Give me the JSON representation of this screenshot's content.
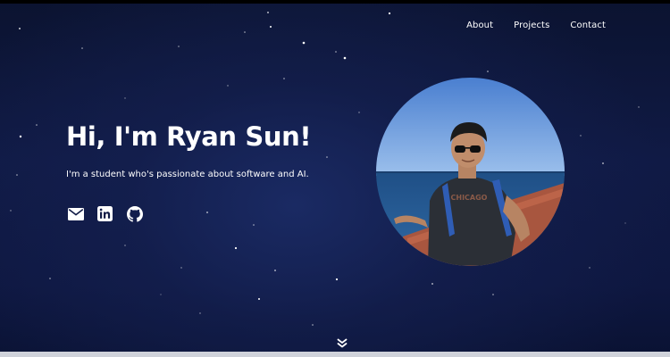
{
  "nav": {
    "items": [
      {
        "label": "About"
      },
      {
        "label": "Projects"
      },
      {
        "label": "Contact"
      }
    ]
  },
  "hero": {
    "title": "Hi, I'm Ryan Sun!",
    "subtitle": "I'm a student who's passionate about software and AI."
  },
  "socials": [
    {
      "icon": "mail-icon"
    },
    {
      "icon": "linkedin-icon"
    },
    {
      "icon": "github-icon"
    }
  ],
  "avatar": {
    "shirt_text": "CHICAGO"
  },
  "colors": {
    "background": "#0e1740",
    "text": "#ffffff",
    "sky": "#5b8fd9",
    "sea": "#24588f",
    "shirt": "#2b2f36"
  }
}
